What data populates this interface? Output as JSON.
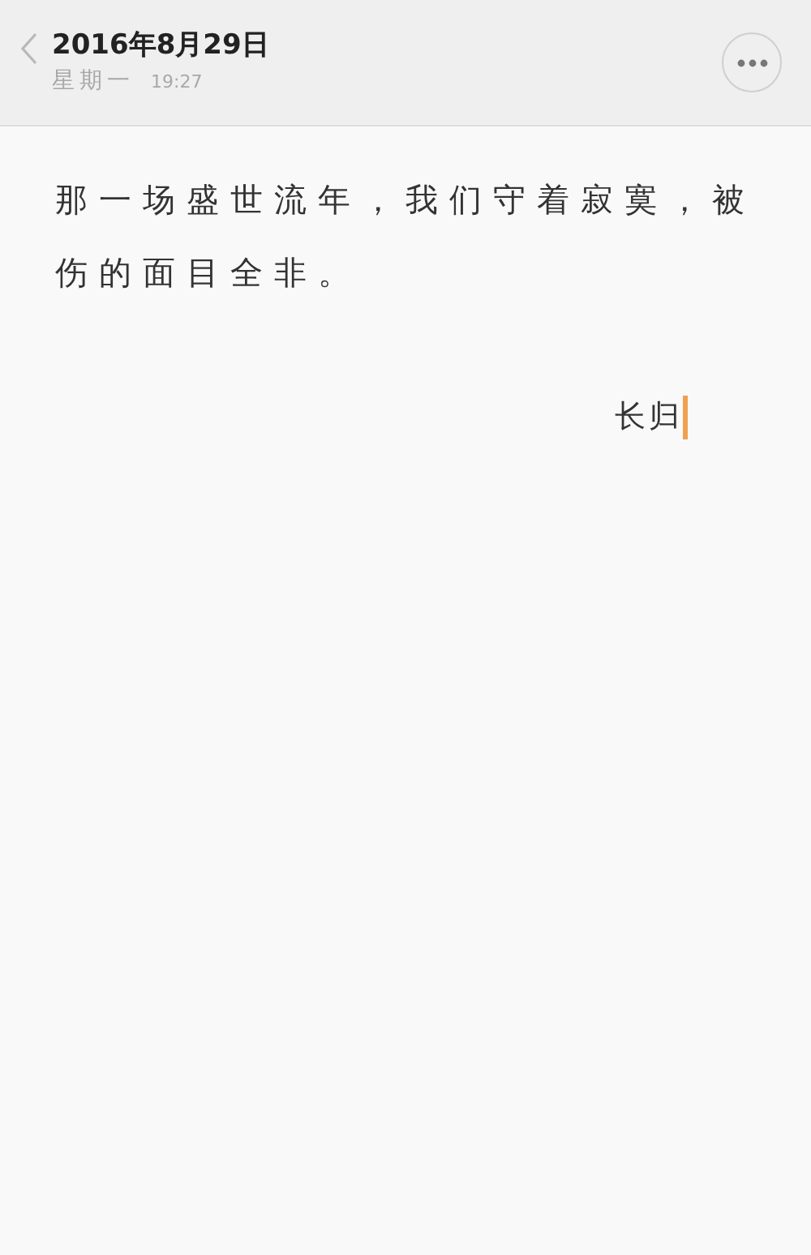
{
  "header": {
    "date": "2016年8月29日",
    "weekday": "星期一",
    "time": "19:27"
  },
  "note": {
    "body": "那一场盛世流年，我们守着寂寞，被伤的面目全非。",
    "signature": "长归"
  }
}
